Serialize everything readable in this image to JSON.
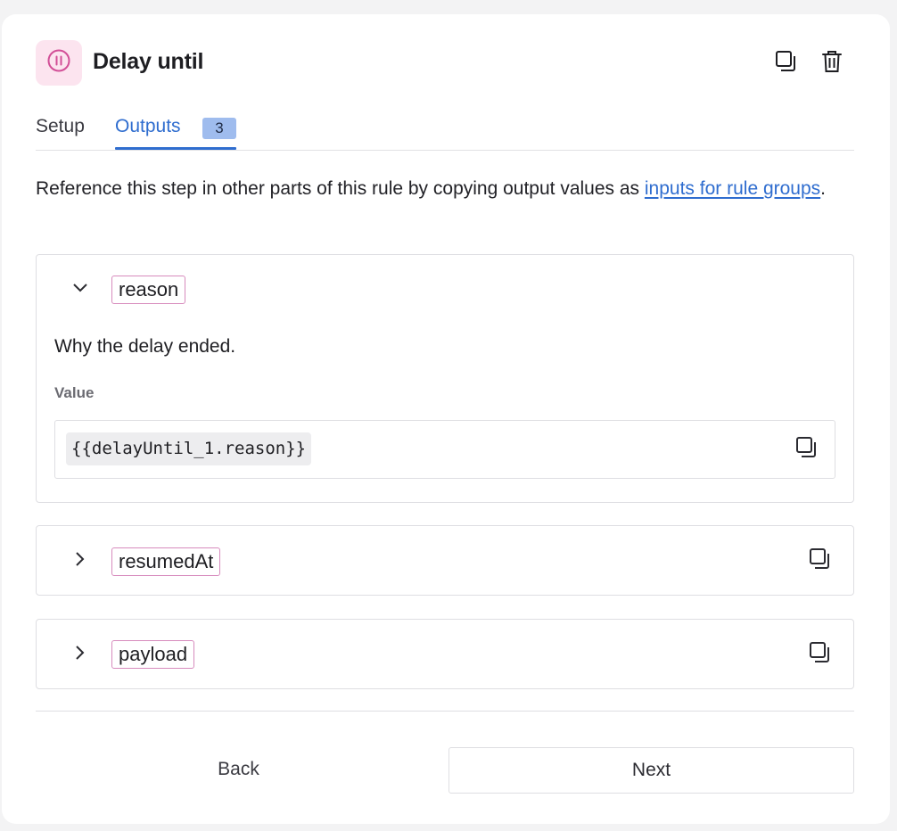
{
  "header": {
    "title": "Delay until",
    "icon": "pause-circle-icon",
    "accent_color": "#d24f97",
    "actions": [
      "copy-icon",
      "trash-icon"
    ]
  },
  "tabs": [
    {
      "label": "Setup",
      "active": false
    },
    {
      "label": "Outputs",
      "active": true,
      "badge": "3"
    }
  ],
  "intro": {
    "text": "Reference this step in other parts of this rule by copying output values as ",
    "link": "inputs for rule groups",
    "suffix": "."
  },
  "outputs": [
    {
      "name": "reason",
      "expanded": true,
      "description": "Why the delay ended.",
      "value_label": "Value",
      "value": "{{delayUntil_1.reason}}"
    },
    {
      "name": "resumedAt",
      "expanded": false
    },
    {
      "name": "payload",
      "expanded": false
    }
  ],
  "footer": {
    "back_label": "Back",
    "next_label": "Next"
  },
  "colors": {
    "link": "#2f6dcf",
    "badge_bg": "#9fbcee",
    "chip_border": "#d78bbd"
  }
}
